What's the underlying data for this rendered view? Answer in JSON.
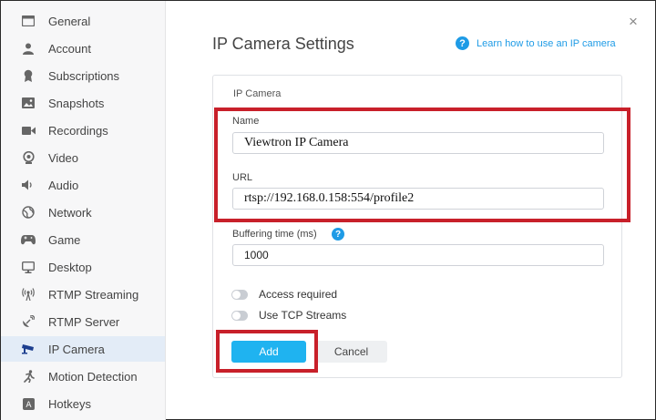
{
  "sidebar": {
    "items": [
      {
        "label": "General",
        "icon": "window-icon"
      },
      {
        "label": "Account",
        "icon": "user-icon"
      },
      {
        "label": "Subscriptions",
        "icon": "badge-icon"
      },
      {
        "label": "Snapshots",
        "icon": "image-icon"
      },
      {
        "label": "Recordings",
        "icon": "video-camera-icon"
      },
      {
        "label": "Video",
        "icon": "webcam-icon"
      },
      {
        "label": "Audio",
        "icon": "speaker-icon"
      },
      {
        "label": "Network",
        "icon": "globe-icon"
      },
      {
        "label": "Game",
        "icon": "gamepad-icon"
      },
      {
        "label": "Desktop",
        "icon": "monitor-icon"
      },
      {
        "label": "RTMP Streaming",
        "icon": "broadcast-icon"
      },
      {
        "label": "RTMP Server",
        "icon": "satellite-icon"
      },
      {
        "label": "IP Camera",
        "icon": "security-camera-icon"
      },
      {
        "label": "Motion Detection",
        "icon": "running-person-icon"
      },
      {
        "label": "Hotkeys",
        "icon": "keyboard-key-icon"
      }
    ],
    "active_index": 12
  },
  "header": {
    "title": "IP Camera Settings",
    "help_link": "Learn how to use an IP camera",
    "close": "×"
  },
  "form": {
    "section": "IP Camera",
    "name_label": "Name",
    "name_value": "Viewtron IP Camera",
    "url_label": "URL",
    "url_value": "rtsp://192.168.0.158:554/profile2",
    "buffering_label": "Buffering time (ms)",
    "buffering_value": "1000",
    "access_required": "Access required",
    "use_tcp": "Use TCP Streams",
    "add": "Add",
    "cancel": "Cancel"
  },
  "colors": {
    "accent": "#1fb3f0",
    "link": "#1e9be6",
    "annotation": "#c8202a",
    "active_item_bg": "#e3ecf7"
  }
}
